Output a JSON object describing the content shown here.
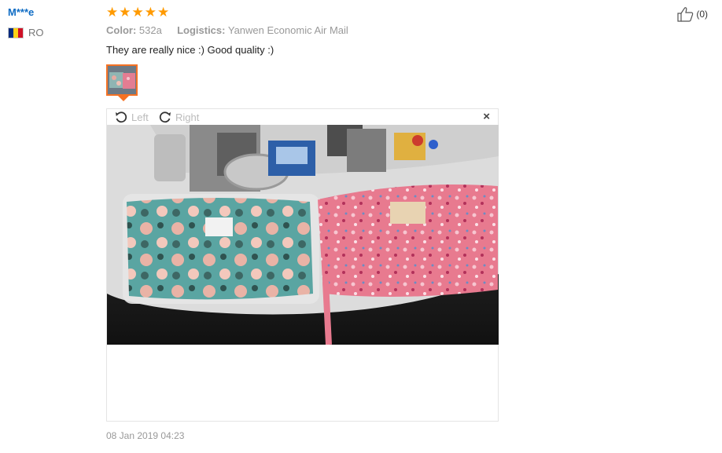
{
  "reviewer": {
    "name": "M***e",
    "country_code": "RO",
    "flag_colors": [
      "#002b7f",
      "#fcd116",
      "#ce1126"
    ]
  },
  "rating": {
    "stars": 5,
    "max": 5,
    "color": "#ff9a00"
  },
  "meta": {
    "color_label": "Color:",
    "color_value": "532a",
    "logistics_label": "Logistics:",
    "logistics_value": "Yanwen Economic Air Mail"
  },
  "review_text": "They are really nice :) Good quality :)",
  "helpful": {
    "count_text": "(0)"
  },
  "viewer": {
    "rotate_left_label": "Left",
    "rotate_right_label": "Right",
    "close_glyph": "×"
  },
  "date": "08 Jan 2019 04:23",
  "accent_color": "#f57224"
}
